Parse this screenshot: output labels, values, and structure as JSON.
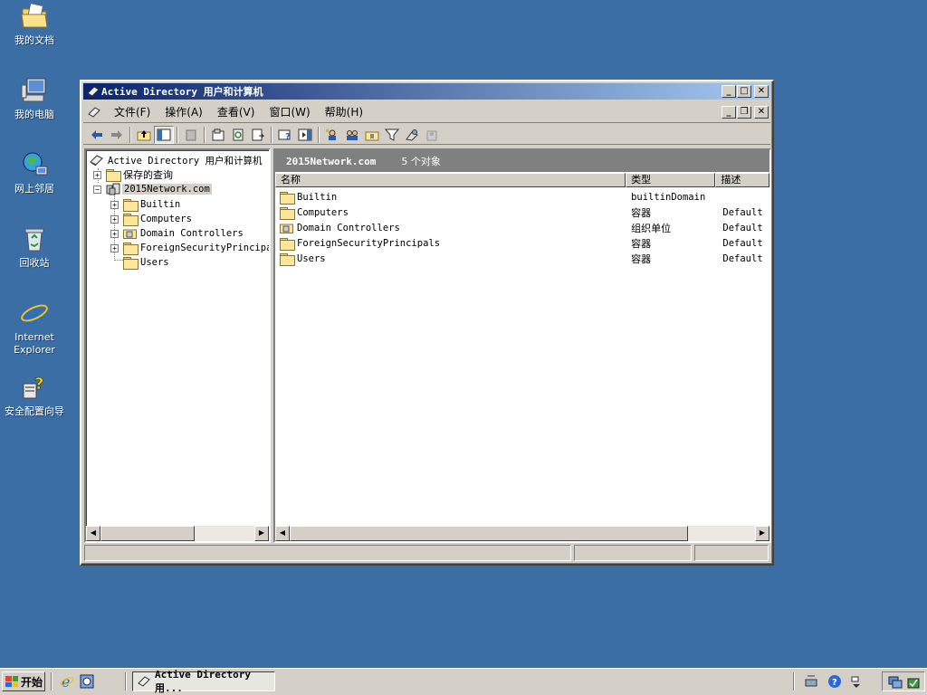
{
  "desktop": {
    "icons": [
      {
        "name": "my-documents",
        "label": "我的文档"
      },
      {
        "name": "my-computer",
        "label": "我的电脑"
      },
      {
        "name": "network-places",
        "label": "网上邻居"
      },
      {
        "name": "recycle-bin",
        "label": "回收站"
      },
      {
        "name": "internet-explorer",
        "label": "Internet Explorer"
      },
      {
        "name": "security-wizard",
        "label": "安全配置向导"
      }
    ]
  },
  "window": {
    "title": "Active Directory 用户和计算机",
    "menu": [
      "文件(F)",
      "操作(A)",
      "查看(V)",
      "窗口(W)",
      "帮助(H)"
    ],
    "tree": {
      "root": "Active Directory 用户和计算机",
      "saved_queries": "保存的查询",
      "domain": "2015Network.com",
      "children": [
        "Builtin",
        "Computers",
        "Domain Controllers",
        "ForeignSecurityPrincipals",
        "Users"
      ]
    },
    "list": {
      "header_domain": "2015Network.com",
      "header_count": "5 个对象",
      "columns": [
        "名称",
        "类型",
        "描述"
      ],
      "rows": [
        {
          "name": "Builtin",
          "type": "builtinDomain",
          "desc": ""
        },
        {
          "name": "Computers",
          "type": "容器",
          "desc": "Default c"
        },
        {
          "name": "Domain Controllers",
          "type": "组织单位",
          "desc": "Default c"
        },
        {
          "name": "ForeignSecurityPrincipals",
          "type": "容器",
          "desc": "Default c"
        },
        {
          "name": "Users",
          "type": "容器",
          "desc": "Default c"
        }
      ]
    }
  },
  "taskbar": {
    "start_label": "开始",
    "task_label": "Active Directory 用..."
  }
}
